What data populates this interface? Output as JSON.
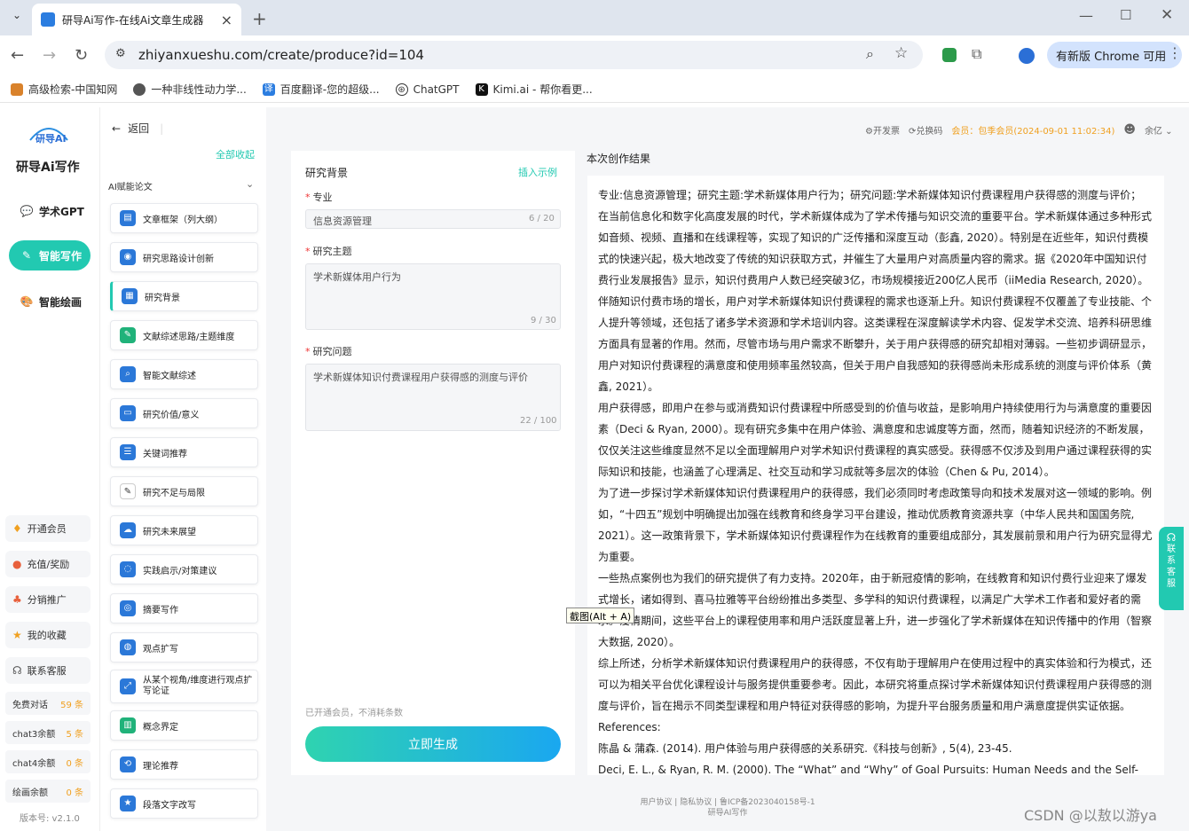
{
  "browser": {
    "tab_title": "研导Ai写作-在线Ai文章生成器",
    "url": "zhiyanxueshu.com/create/produce?id=104",
    "update_btn": "有新版 Chrome 可用",
    "bookmarks": [
      "高级检索-中国知网",
      "一种非线性动力学...",
      "百度翻译-您的超级...",
      "ChatGPT",
      "Kimi.ai - 帮你看更..."
    ]
  },
  "header": {
    "invoice": "开发票",
    "redeem": "兑换码",
    "member": "会员：包季会员(2024-09-01 11:02:34)",
    "user": "余亿"
  },
  "nav": {
    "brand": "研导Ai写作",
    "items": [
      "学术GPT",
      "智能写作",
      "智能绘画"
    ],
    "utils": [
      "开通会员",
      "充值/奖励",
      "分销推广",
      "我的收藏",
      "联系客服"
    ],
    "quotas": [
      {
        "label": "免费对话",
        "value": "59 条"
      },
      {
        "label": "chat3余额",
        "value": "5 条"
      },
      {
        "label": "chat4余额",
        "value": "0 条"
      },
      {
        "label": "绘画余额",
        "value": "0 条"
      }
    ],
    "version": "版本号: v2.1.0"
  },
  "tools": {
    "back": "返回",
    "collapse_all": "全部收起",
    "group": "AI赋能论文",
    "items": [
      "文章框架（列大纲）",
      "研究思路设计创新",
      "研究背景",
      "文献综述思路/主题维度",
      "智能文献综述",
      "研究价值/意义",
      "关键词推荐",
      "研究不足与局限",
      "研究未来展望",
      "实践启示/对策建议",
      "摘要写作",
      "观点扩写",
      "从某个视角/维度进行观点扩写论证",
      "概念界定",
      "理论推荐",
      "段落文字改写"
    ]
  },
  "form": {
    "title": "研究背景",
    "example": "插入示例",
    "major_label": "专业",
    "major_value": "信息资源管理",
    "major_count": "6 / 20",
    "topic_label": "研究主题",
    "topic_value": "学术新媒体用户行为",
    "topic_count": "9 / 30",
    "question_label": "研究问题",
    "question_value": "学术新媒体知识付费课程用户获得感的测度与评价",
    "question_count": "22 / 100",
    "note": "已开通会员，不消耗条数",
    "generate": "立即生成"
  },
  "result": {
    "title": "本次创作结果",
    "paragraphs": [
      "专业:信息资源管理；研究主题:学术新媒体用户行为；研究问题:学术新媒体知识付费课程用户获得感的测度与评价；",
      "在当前信息化和数字化高度发展的时代，学术新媒体成为了学术传播与知识交流的重要平台。学术新媒体通过多种形式如音频、视频、直播和在线课程等，实现了知识的广泛传播和深度互动（彭鑫, 2020）。特别是在近些年，知识付费模式的快速兴起，极大地改变了传统的知识获取方式，并催生了大量用户对高质量内容的需求。据《2020年中国知识付费行业发展报告》显示，知识付费用户人数已经突破3亿，市场规模接近200亿人民币（iiMedia Research, 2020）。伴随知识付费市场的增长，用户对学术新媒体知识付费课程的需求也逐渐上升。知识付费课程不仅覆盖了专业技能、个人提升等领域，还包括了诸多学术资源和学术培训内容。这类课程在深度解读学术内容、促发学术交流、培养科研思维方面具有显著的作用。然而，尽管市场与用户需求不断攀升，关于用户获得感的研究却相对薄弱。一些初步调研显示，用户对知识付费课程的满意度和使用频率虽然较高，但关于用户自我感知的获得感尚未形成系统的测度与评价体系（黄鑫, 2021）。",
      "用户获得感，即用户在参与或消费知识付费课程中所感受到的价值与收益，是影响用户持续使用行为与满意度的重要因素（Deci & Ryan, 2000）。现有研究多集中在用户体验、满意度和忠诚度等方面，然而，随着知识经济的不断发展，仅仅关注这些维度显然不足以全面理解用户对学术知识付费课程的真实感受。获得感不仅涉及到用户通过课程获得的实际知识和技能，也涵盖了心理满足、社交互动和学习成就等多层次的体验（Chen & Pu, 2014）。",
      "为了进一步探讨学术新媒体知识付费课程用户的获得感，我们必须同时考虑政策导向和技术发展对这一领域的影响。例如，“十四五”规划中明确提出加强在线教育和终身学习平台建设，推动优质教育资源共享（中华人民共和国国务院, 2021）。这一政策背景下，学术新媒体知识付费课程作为在线教育的重要组成部分，其发展前景和用户行为研究显得尤为重要。",
      "一些热点案例也为我们的研究提供了有力支持。2020年，由于新冠疫情的影响，在线教育和知识付费行业迎来了爆发式增长，诸如得到、喜马拉雅等平台纷纷推出多类型、多学科的知识付费课程，以满足广大学术工作者和爱好者的需求。疫情期间，这些平台上的课程使用率和用户活跃度显著上升，进一步强化了学术新媒体在知识传播中的作用（智察大数据, 2020）。",
      "综上所述，分析学术新媒体知识付费课程用户的获得感，不仅有助于理解用户在使用过程中的真实体验和行为模式，还可以为相关平台优化课程设计与服务提供重要参考。因此，本研究将重点探讨学术新媒体知识付费课程用户获得感的测度与评价，旨在揭示不同类型课程和用户特征对获得感的影响，为提升平台服务质量和用户满意度提供实证依据。",
      "References:",
      "陈晶 & 蒲森. (2014). 用户体验与用户获得感的关系研究.《科技与创新》, 5(4), 23-45.",
      "Deci, E. L., & Ryan, R. M. (2000). The “What” and “Why” of Goal Pursuits: Human Needs and the Self-"
    ]
  },
  "tooltip": "截图(Alt + A)",
  "kefu": "联系客服",
  "footer": {
    "line1": "用户协议 | 隐私协议 | 鲁ICP备2023040158号-1",
    "line2": "研导AI写作"
  },
  "watermark": "CSDN @以敖以游ya",
  "colors": {
    "accent": "#22c9b1",
    "gradient_end": "#1aa7f0",
    "quota": "#f0a020",
    "member": "#f0a020"
  }
}
